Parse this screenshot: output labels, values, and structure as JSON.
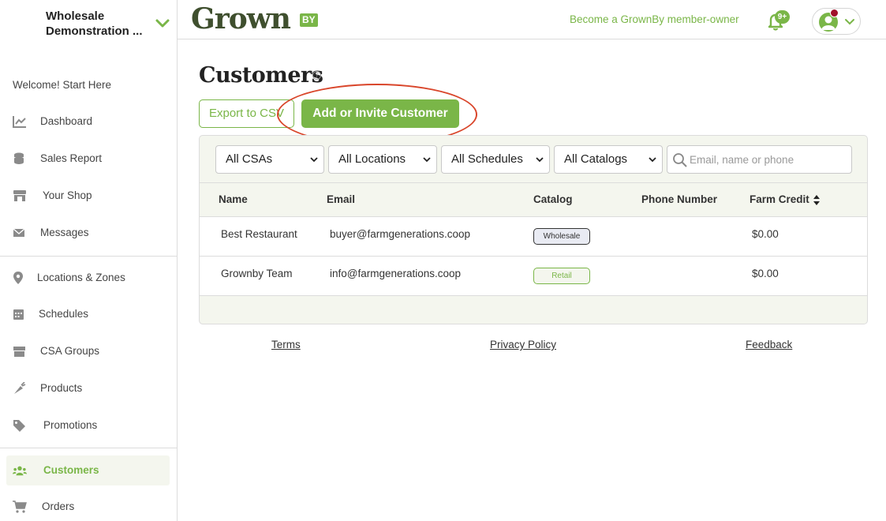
{
  "store": {
    "name_line1": "Wholesale",
    "name_line2": "Demonstration ..."
  },
  "sidebar": {
    "welcome": "Welcome! Start Here",
    "items": [
      {
        "label": "Dashboard",
        "icon": "chart-line-icon"
      },
      {
        "label": "Sales Report",
        "icon": "coins-icon"
      },
      {
        "label": "Your Shop",
        "icon": "store-icon"
      },
      {
        "label": "Messages",
        "icon": "envelope-icon"
      },
      {
        "label": "Locations & Zones",
        "icon": "map-pin-icon"
      },
      {
        "label": "Schedules",
        "icon": "calendar-icon"
      },
      {
        "label": "CSA Groups",
        "icon": "box-icon"
      },
      {
        "label": "Products",
        "icon": "carrot-icon"
      },
      {
        "label": "Promotions",
        "icon": "tags-icon"
      },
      {
        "label": "Customers",
        "icon": "users-icon",
        "active": true
      },
      {
        "label": "Orders",
        "icon": "cart-icon"
      }
    ]
  },
  "header": {
    "logo_text": "Grown",
    "logo_badge": "BY",
    "member_link": "Become a GrownBy member-owner",
    "notif_count": "9+"
  },
  "page": {
    "title": "Customers",
    "help": "?",
    "export_label": "Export to CSV",
    "add_label": "Add or Invite Customer"
  },
  "filters": {
    "csa": "All CSAs",
    "locations": "All Locations",
    "schedules": "All Schedules",
    "catalogs": "All Catalogs",
    "search_placeholder": "Email, name or phone"
  },
  "table": {
    "columns": [
      "Name",
      "Email",
      "Catalog",
      "Phone Number",
      "Farm Credit"
    ],
    "rows": [
      {
        "name": "Best Restaurant",
        "email": "buyer@farmgenerations.coop",
        "catalog": "Wholesale",
        "phone": "",
        "credit": "$0.00"
      },
      {
        "name": "Grownby Team",
        "email": "info@farmgenerations.coop",
        "catalog": "Retail",
        "phone": "",
        "credit": "$0.00"
      }
    ]
  },
  "footer": {
    "terms": "Terms",
    "privacy": "Privacy Policy",
    "feedback": "Feedback"
  },
  "colors": {
    "accent": "#7ab648",
    "highlight": "#d9462b",
    "panel": "#f4f6ee"
  }
}
